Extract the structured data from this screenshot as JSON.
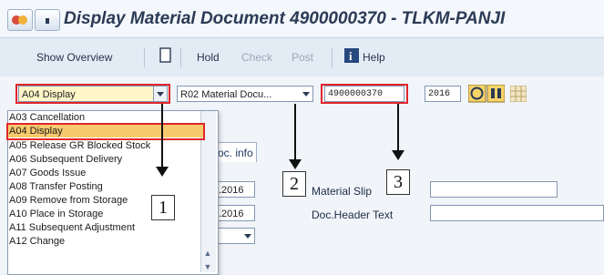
{
  "title": {
    "text": "Display Material Document 4900000370 - TLKM-PANJI"
  },
  "toolbar": {
    "show_overview": "Show Overview",
    "hold": "Hold",
    "check": "Check",
    "post": "Post",
    "help": "Help"
  },
  "selection": {
    "action_value": "A04 Display",
    "reference_value": "R02 Material Docu...",
    "doc_number": "4900000370",
    "year": "2016"
  },
  "dropdown": {
    "items": [
      "A03 Cancellation",
      "A04 Display",
      "A05 Release GR Blocked Stock",
      "A06 Subsequent Delivery",
      "A07 Goods Issue",
      "A08 Transfer Posting",
      "A09 Remove from Storage",
      "A10 Place in Storage",
      "A11 Subsequent Adjustment",
      "A12 Change"
    ],
    "selected_index": 1
  },
  "tab": {
    "label": "oc. info"
  },
  "fields": {
    "date1": ".2016",
    "date2": ".2016",
    "material_slip_label": "Material Slip",
    "doc_header_label": "Doc.Header Text"
  },
  "callouts": {
    "one": "1",
    "two": "2",
    "three": "3"
  },
  "colors": {
    "highlight": "#e0262c",
    "selected": "#f7ca6e",
    "title": "#2b3a55"
  }
}
